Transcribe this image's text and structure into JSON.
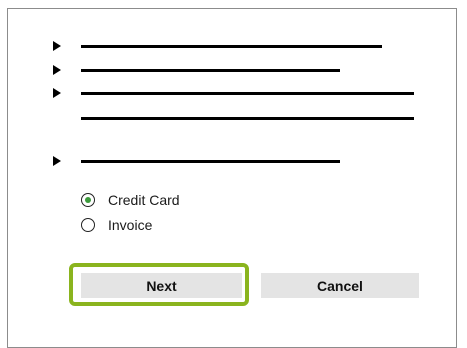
{
  "payment": {
    "options": [
      {
        "label": "Credit Card",
        "checked": true
      },
      {
        "label": "Invoice",
        "checked": false
      }
    ],
    "accent_color": "#3c9a3c"
  },
  "buttons": {
    "next_label": "Next",
    "cancel_label": "Cancel"
  },
  "highlight_color": "#8ab41e"
}
